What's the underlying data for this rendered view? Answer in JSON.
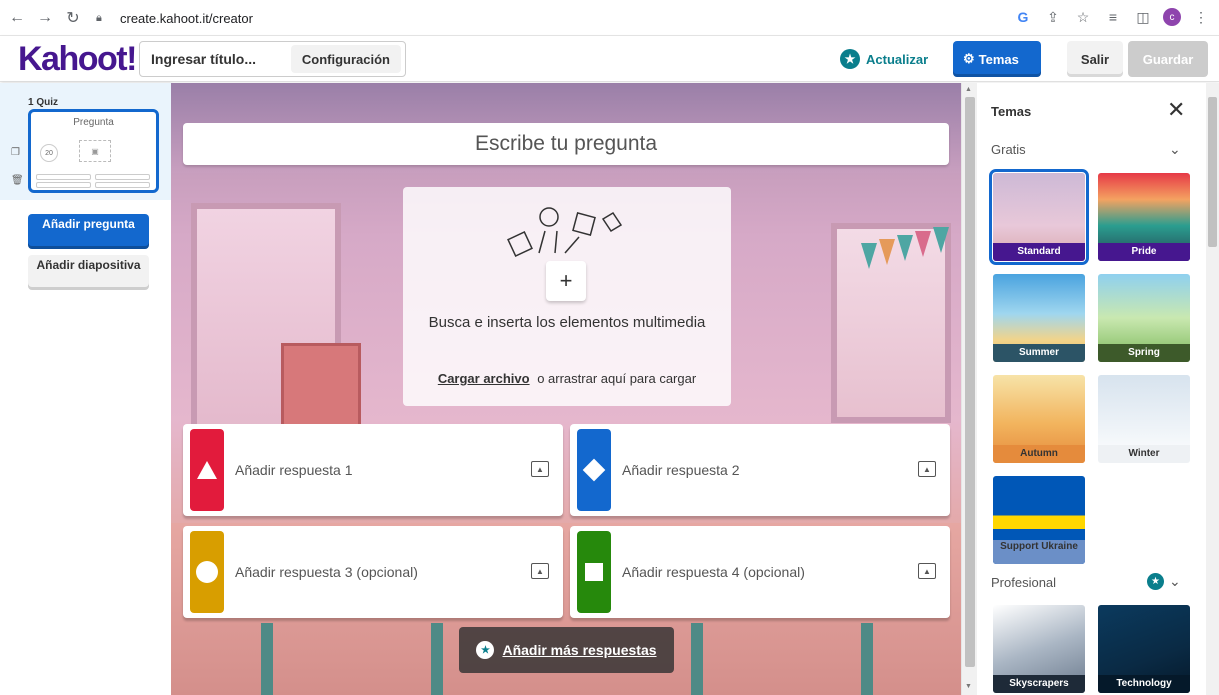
{
  "browser": {
    "url": "create.kahoot.it/creator",
    "avatar_letter": "c"
  },
  "topbar": {
    "logo": "Kahoot!",
    "title_placeholder": "Ingresar título...",
    "settings_label": "Configuración",
    "upgrade_label": "Actualizar",
    "themes_label": "Temas",
    "exit_label": "Salir",
    "save_label": "Guardar"
  },
  "sidebar": {
    "slide_number": "1  Quiz",
    "slide_title": "Pregunta",
    "slide_timer": "20",
    "add_question_label": "Añadir pregunta",
    "add_slide_label": "Añadir diapositiva"
  },
  "editor": {
    "question_placeholder": "Escribe tu pregunta",
    "media_prompt": "Busca e inserta los elementos multimedia",
    "upload_link": "Cargar archivo",
    "upload_hint": "o arrastrar aquí para cargar",
    "answers": [
      {
        "label": "Añadir respuesta 1",
        "color": "#e21b3c",
        "shape": "triangle"
      },
      {
        "label": "Añadir respuesta 2",
        "color": "#1368ce",
        "shape": "diamond"
      },
      {
        "label": "Añadir respuesta 3 (opcional)",
        "color": "#d89e00",
        "shape": "circle"
      },
      {
        "label": "Añadir respuesta 4 (opcional)",
        "color": "#26890c",
        "shape": "square"
      }
    ],
    "more_answers_label": "Añadir más respuestas"
  },
  "themes_panel": {
    "title": "Temas",
    "free_section": "Gratis",
    "pro_section": "Profesional",
    "free_themes": [
      "Standard",
      "Pride",
      "Summer",
      "Spring",
      "Autumn",
      "Winter",
      "Support Ukraine"
    ],
    "selected_theme": "Standard",
    "pro_themes": [
      "Skyscrapers",
      "Technology"
    ]
  },
  "colors": {
    "brand_purple": "#46178f",
    "primary_blue": "#1368ce",
    "teal": "#0a7e8c"
  }
}
